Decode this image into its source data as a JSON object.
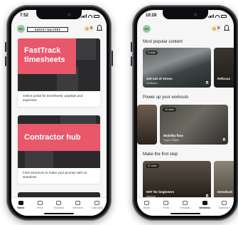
{
  "left_phone": {
    "status_time": "7:52",
    "avatar_initials": "BM",
    "brand_text": "HARVEY WALTERS",
    "coins": "0",
    "cards": [
      {
        "title_line1": "FastTrack",
        "title_line2": "timesheets",
        "desc": "Online portal for timesheets, payslips and expenses"
      },
      {
        "title_line1": "Contractor hub",
        "title_line2": "",
        "desc": "Find resources to make your journey with us seamless"
      }
    ],
    "tabs": [
      "Home",
      "Perks",
      "Rewards",
      "Wellness",
      "Calendars"
    ],
    "active_tab": 0
  },
  "right_phone": {
    "status_time": "10:28",
    "avatar_initials": "BM",
    "coins": "0",
    "sections": [
      {
        "title": "Most popular content",
        "tiles": [
          {
            "badge": "3 mins",
            "name": "Get out of stress",
            "sub": "Meditation"
          },
          {
            "badge": "",
            "name": "Refocus",
            "sub": ""
          }
        ]
      },
      {
        "title": "Power up your workouts",
        "tiles": [
          {
            "badge": "",
            "name": "",
            "sub": ""
          },
          {
            "badge": "10 mins",
            "name": "Mobility flow",
            "sub": "Yoga & Pilates"
          }
        ]
      },
      {
        "title": "Make the first step",
        "tiles": [
          {
            "badge": "27 mins",
            "name": "HIIT for beginners",
            "sub": "Workout"
          },
          {
            "badge": "",
            "name": "Introducti",
            "sub": ""
          }
        ]
      }
    ],
    "tabs": [
      "Home",
      "Perks",
      "Rewards",
      "Wellness",
      "Calendars"
    ],
    "active_tab": 3
  },
  "colors": {
    "accent_pink": "#e8576a",
    "coin": "#f3b433",
    "avatar_green": "#9ec9a6"
  },
  "icons": [
    "home-icon",
    "perks-icon",
    "rewards-icon",
    "wellness-icon",
    "calendar-icon",
    "bell-icon",
    "coin-icon",
    "bookmark-icon"
  ]
}
